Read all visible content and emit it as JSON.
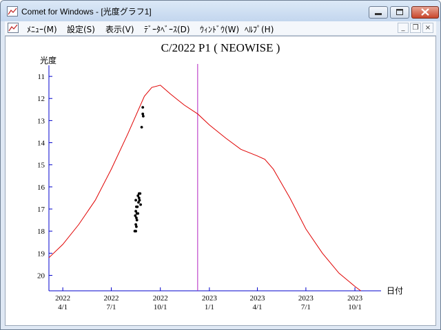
{
  "window": {
    "title": "Comet for Windows - [光度グラフ1]"
  },
  "menu": {
    "items": [
      "ﾒﾆｭｰ(M)",
      "設定(S)",
      "表示(V)",
      "ﾃﾞｰﾀﾍﾞｰｽ(D)",
      "ｳｨﾝﾄﾞｳ(W)",
      "ﾍﾙﾌﾟ(H)"
    ]
  },
  "mdi_controls": [
    "minimize-icon",
    "restore-icon",
    "close-icon"
  ],
  "chart_data": {
    "type": "line",
    "title": "C/2022 P1 ( NEOWISE )",
    "ylabel": "光度",
    "xlabel": "日付",
    "y_inverted": true,
    "ylim": [
      10.5,
      20.7
    ],
    "y_ticks": [
      11,
      12,
      13,
      14,
      15,
      16,
      17,
      18,
      19,
      20
    ],
    "xlim": [
      "2022-03-06",
      "2023-11-19"
    ],
    "x_ticks": [
      {
        "date": "2022-04-01",
        "year": "2022",
        "md": "4/1"
      },
      {
        "date": "2022-07-01",
        "year": "2022",
        "md": "7/1"
      },
      {
        "date": "2022-10-01",
        "year": "2022",
        "md": "10/1"
      },
      {
        "date": "2023-01-01",
        "year": "2023",
        "md": "1/1"
      },
      {
        "date": "2023-04-01",
        "year": "2023",
        "md": "4/1"
      },
      {
        "date": "2023-07-01",
        "year": "2023",
        "md": "7/1"
      },
      {
        "date": "2023-10-01",
        "year": "2023",
        "md": "10/1"
      }
    ],
    "current_date": "2022-12-10",
    "colors": {
      "curve": "#e00000",
      "marker_line": "#b020c0",
      "axes": "#0000cc",
      "observations": "#000000"
    },
    "series": [
      {
        "kind": "curve",
        "points": [
          [
            "2022-03-06",
            19.2
          ],
          [
            "2022-04-01",
            18.6
          ],
          [
            "2022-05-01",
            17.7
          ],
          [
            "2022-06-01",
            16.6
          ],
          [
            "2022-07-01",
            15.2
          ],
          [
            "2022-08-01",
            13.6
          ],
          [
            "2022-09-01",
            11.9
          ],
          [
            "2022-09-15",
            11.5
          ],
          [
            "2022-10-01",
            11.4
          ],
          [
            "2022-10-20",
            11.8
          ],
          [
            "2022-11-15",
            12.3
          ],
          [
            "2022-12-10",
            12.7
          ],
          [
            "2023-01-01",
            13.2
          ],
          [
            "2023-02-01",
            13.8
          ],
          [
            "2023-03-01",
            14.3
          ],
          [
            "2023-04-01",
            14.6
          ],
          [
            "2023-04-15",
            14.75
          ],
          [
            "2023-05-01",
            15.2
          ],
          [
            "2023-06-01",
            16.5
          ],
          [
            "2023-07-01",
            17.9
          ],
          [
            "2023-08-01",
            19.0
          ],
          [
            "2023-09-01",
            19.9
          ],
          [
            "2023-10-01",
            20.5
          ],
          [
            "2023-10-12",
            20.7
          ]
        ]
      },
      {
        "kind": "observations",
        "points": [
          [
            "2022-08-29",
            12.4
          ],
          [
            "2022-08-29",
            12.7
          ],
          [
            "2022-08-30",
            12.8
          ],
          [
            "2022-08-27",
            13.3
          ],
          [
            "2022-08-22",
            16.3
          ],
          [
            "2022-08-24",
            16.3
          ],
          [
            "2022-08-20",
            16.4
          ],
          [
            "2022-08-22",
            16.5
          ],
          [
            "2022-08-23",
            16.6
          ],
          [
            "2022-08-21",
            16.7
          ],
          [
            "2022-08-25",
            16.8
          ],
          [
            "2022-08-16",
            16.6
          ],
          [
            "2022-08-17",
            16.9
          ],
          [
            "2022-08-19",
            16.9
          ],
          [
            "2022-08-16",
            17.1
          ],
          [
            "2022-08-18",
            17.2
          ],
          [
            "2022-08-20",
            17.2
          ],
          [
            "2022-08-15",
            17.3
          ],
          [
            "2022-08-17",
            17.4
          ],
          [
            "2022-08-18",
            17.5
          ],
          [
            "2022-08-16",
            17.7
          ],
          [
            "2022-08-17",
            17.8
          ],
          [
            "2022-08-14",
            18.0
          ],
          [
            "2022-08-16",
            18.0
          ]
        ]
      }
    ]
  }
}
